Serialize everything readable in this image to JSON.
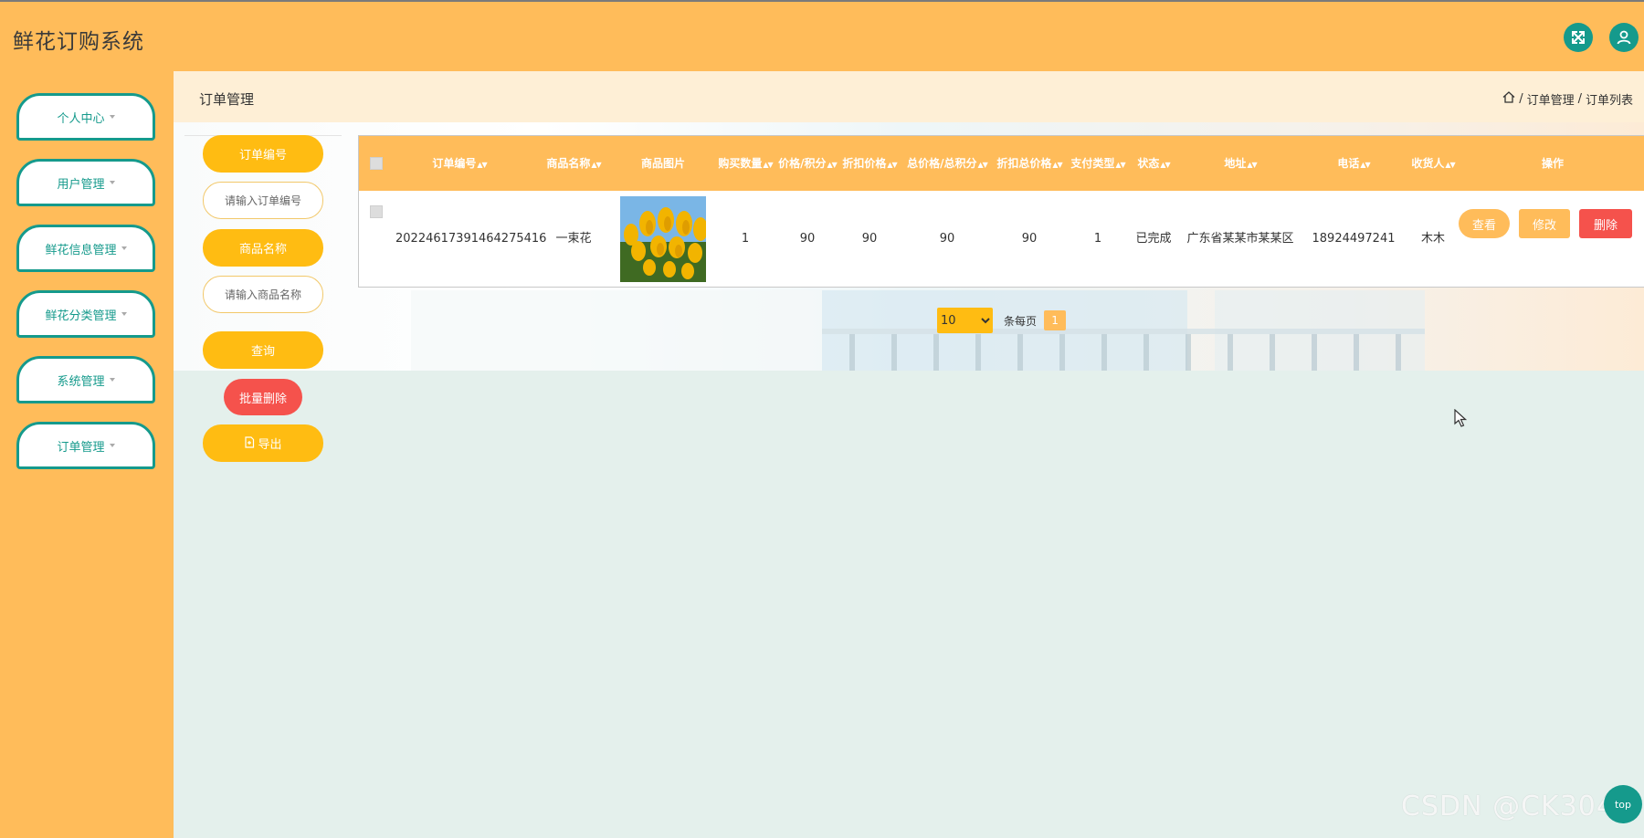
{
  "app": {
    "title": "鲜花订购系统"
  },
  "header": {
    "fullscreen_icon": "expand-icon",
    "user_icon": "user-icon"
  },
  "sidebar": {
    "items": [
      {
        "label": "个人中心"
      },
      {
        "label": "用户管理"
      },
      {
        "label": "鲜花信息管理"
      },
      {
        "label": "鲜花分类管理"
      },
      {
        "label": "系统管理"
      },
      {
        "label": "订单管理"
      }
    ]
  },
  "page": {
    "title": "订单管理",
    "breadcrumb": {
      "home_icon": "home-icon",
      "level1": "订单管理",
      "level2": "订单列表",
      "separator": "/"
    }
  },
  "search": {
    "order_no_label": "订单编号",
    "order_no_placeholder": "请输入订单编号",
    "product_name_label": "商品名称",
    "product_name_placeholder": "请输入商品名称",
    "search_button": "查询",
    "batch_delete_button": "批量删除",
    "export_button": "导出"
  },
  "table": {
    "columns": [
      "订单编号",
      "商品名称",
      "商品图片",
      "购买数量",
      "价格/积分",
      "折扣价格",
      "总价格/总积分",
      "折扣总价格",
      "支付类型",
      "状态",
      "地址",
      "电话",
      "收货人",
      "操作"
    ],
    "rows": [
      {
        "order_no": "20224617391464275416",
        "product_name": "一束花",
        "quantity": "1",
        "price": "90",
        "discount_price": "90",
        "total_price": "90",
        "discount_total": "90",
        "pay_type": "1",
        "status": "已完成",
        "address": "广东省某某市某某区",
        "phone": "18924497241",
        "receiver": "木木",
        "actions": {
          "view": "查看",
          "edit": "修改",
          "delete": "删除"
        }
      }
    ]
  },
  "pagination": {
    "page_size": "10",
    "page_size_options": [
      "10"
    ],
    "per_page_label": "条每页",
    "current_page": "1"
  },
  "watermark": "CSDN @CK3043",
  "back_to_top": "top",
  "colors": {
    "primary": "#ffbc5a",
    "accent": "#159a8c",
    "button": "#ffbc12",
    "danger": "#f5524c"
  }
}
